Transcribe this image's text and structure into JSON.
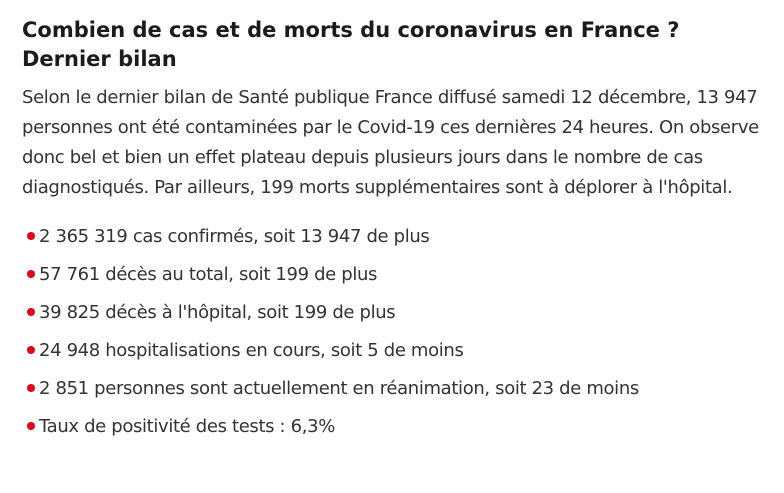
{
  "article": {
    "headline": "Combien de cas et de morts du coronavirus en France ? Dernier bilan",
    "lead": "Selon le dernier bilan de Santé publique France diffusé samedi 12 décembre, 13 947 personnes ont été contaminées par le Covid-19 ces dernières 24 heures. On observe donc bel et bien un effet plateau depuis plusieurs jours dans le nombre de cas diagnostiqués. Par ailleurs, 199 morts supplémentaires sont à déplorer à l'hôpital.",
    "bullets": [
      "2 365 319 cas confirmés, soit 13 947 de plus",
      "57 761 décès au total, soit 199 de plus",
      "39 825 décès à l'hôpital, soit 199 de plus",
      "24 948 hospitalisations en cours, soit 5 de moins",
      "2 851 personnes sont actuellement en réanimation, soit 23 de moins",
      "Taux de positivité des tests : 6,3%"
    ]
  },
  "colors": {
    "bullet_dot": "#e2001a",
    "headline": "#1b1b1b",
    "body_text": "#333333"
  },
  "icons": {
    "bullet": "red-dot-icon"
  }
}
